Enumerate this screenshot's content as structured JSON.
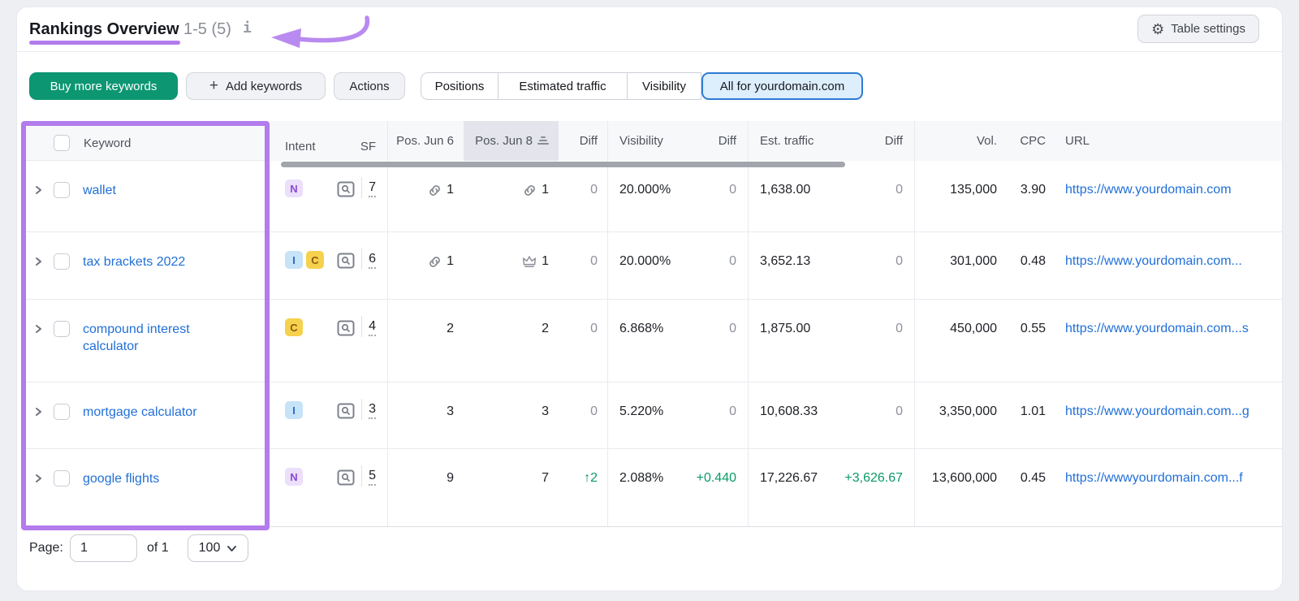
{
  "header": {
    "title": "Rankings Overview",
    "count": "1-5 (5)",
    "table_settings_label": "Table settings"
  },
  "toolbar": {
    "buy_label": "Buy more keywords",
    "add_label": "Add keywords",
    "actions_label": "Actions",
    "segments": [
      "Positions",
      "Estimated traffic",
      "Visibility",
      "All for yourdomain.com"
    ],
    "selected_segment": "All for yourdomain.com"
  },
  "table": {
    "columns": {
      "keyword": "Keyword",
      "intent": "Intent",
      "sf": "SF",
      "pos1": "Pos. Jun 6",
      "pos2": "Pos. Jun 8",
      "pos_diff": "Diff",
      "visibility": "Visibility",
      "vis_diff": "Diff",
      "est_traffic": "Est. traffic",
      "traffic_diff": "Diff",
      "volume": "Vol.",
      "cpc": "CPC",
      "url": "URL"
    },
    "sorted_column": "Pos. Jun 8",
    "rows": [
      {
        "keyword": "wallet",
        "intents": [
          {
            "label": "N",
            "type": "navigational"
          }
        ],
        "sf": "7",
        "pos1": {
          "icon": "link-icon",
          "value": "1"
        },
        "pos2": {
          "icon": "link-icon",
          "value": "1"
        },
        "pos_diff": "0",
        "visibility": "20.000%",
        "vis_diff": "0",
        "est_traffic": "1,638.00",
        "traffic_diff": "0",
        "volume": "135,000",
        "cpc": "3.90",
        "url": "https://www.yourdomain.com"
      },
      {
        "keyword": "tax brackets 2022",
        "intents": [
          {
            "label": "I",
            "type": "informational"
          },
          {
            "label": "C",
            "type": "commercial"
          }
        ],
        "sf": "6",
        "pos1": {
          "icon": "link-icon",
          "value": "1"
        },
        "pos2": {
          "icon": "crown-icon",
          "value": "1"
        },
        "pos_diff": "0",
        "visibility": "20.000%",
        "vis_diff": "0",
        "est_traffic": "3,652.13",
        "traffic_diff": "0",
        "volume": "301,000",
        "cpc": "0.48",
        "url": "https://www.yourdomain.com..."
      },
      {
        "keyword": "compound interest calculator",
        "intents": [
          {
            "label": "C",
            "type": "commercial"
          }
        ],
        "sf": "4",
        "pos1": {
          "icon": null,
          "value": "2"
        },
        "pos2": {
          "icon": null,
          "value": "2"
        },
        "pos_diff": "0",
        "visibility": "6.868%",
        "vis_diff": "0",
        "est_traffic": "1,875.00",
        "traffic_diff": "0",
        "volume": "450,000",
        "cpc": "0.55",
        "url": "https://www.yourdomain.com...s"
      },
      {
        "keyword": "mortgage calculator",
        "intents": [
          {
            "label": "I",
            "type": "informational"
          }
        ],
        "sf": "3",
        "pos1": {
          "icon": null,
          "value": "3"
        },
        "pos2": {
          "icon": null,
          "value": "3"
        },
        "pos_diff": "0",
        "visibility": "5.220%",
        "vis_diff": "0",
        "est_traffic": "10,608.33",
        "traffic_diff": "0",
        "volume": "3,350,000",
        "cpc": "1.01",
        "url": "https://www.yourdomain.com...g"
      },
      {
        "keyword": "google flights",
        "intents": [
          {
            "label": "N",
            "type": "navigational"
          }
        ],
        "sf": "5",
        "pos1": {
          "icon": null,
          "value": "9"
        },
        "pos2": {
          "icon": null,
          "value": "7"
        },
        "pos_diff": "↑2",
        "visibility": "2.088%",
        "vis_diff": "+0.440",
        "est_traffic": "17,226.67",
        "traffic_diff": "+3,626.67",
        "volume": "13,600,000",
        "cpc": "0.45",
        "url": "https://wwwyourdomain.com...f"
      }
    ]
  },
  "pagination": {
    "label": "Page:",
    "page": "1",
    "of": "of 1",
    "per_page": "100"
  },
  "colors": {
    "accent_purple": "#b27cec",
    "buy_green": "#0c9672",
    "selected_blue_border": "#2d7bd4",
    "selected_blue_bg": "#ddeefc",
    "link_blue": "#2270d7",
    "positive_green": "#0b9a66",
    "badge_n_bg": "#ecdffb",
    "badge_i_bg": "#c6e3f8",
    "badge_c_bg": "#f6d14d",
    "sorted_header_bg": "#e4e5ec"
  }
}
